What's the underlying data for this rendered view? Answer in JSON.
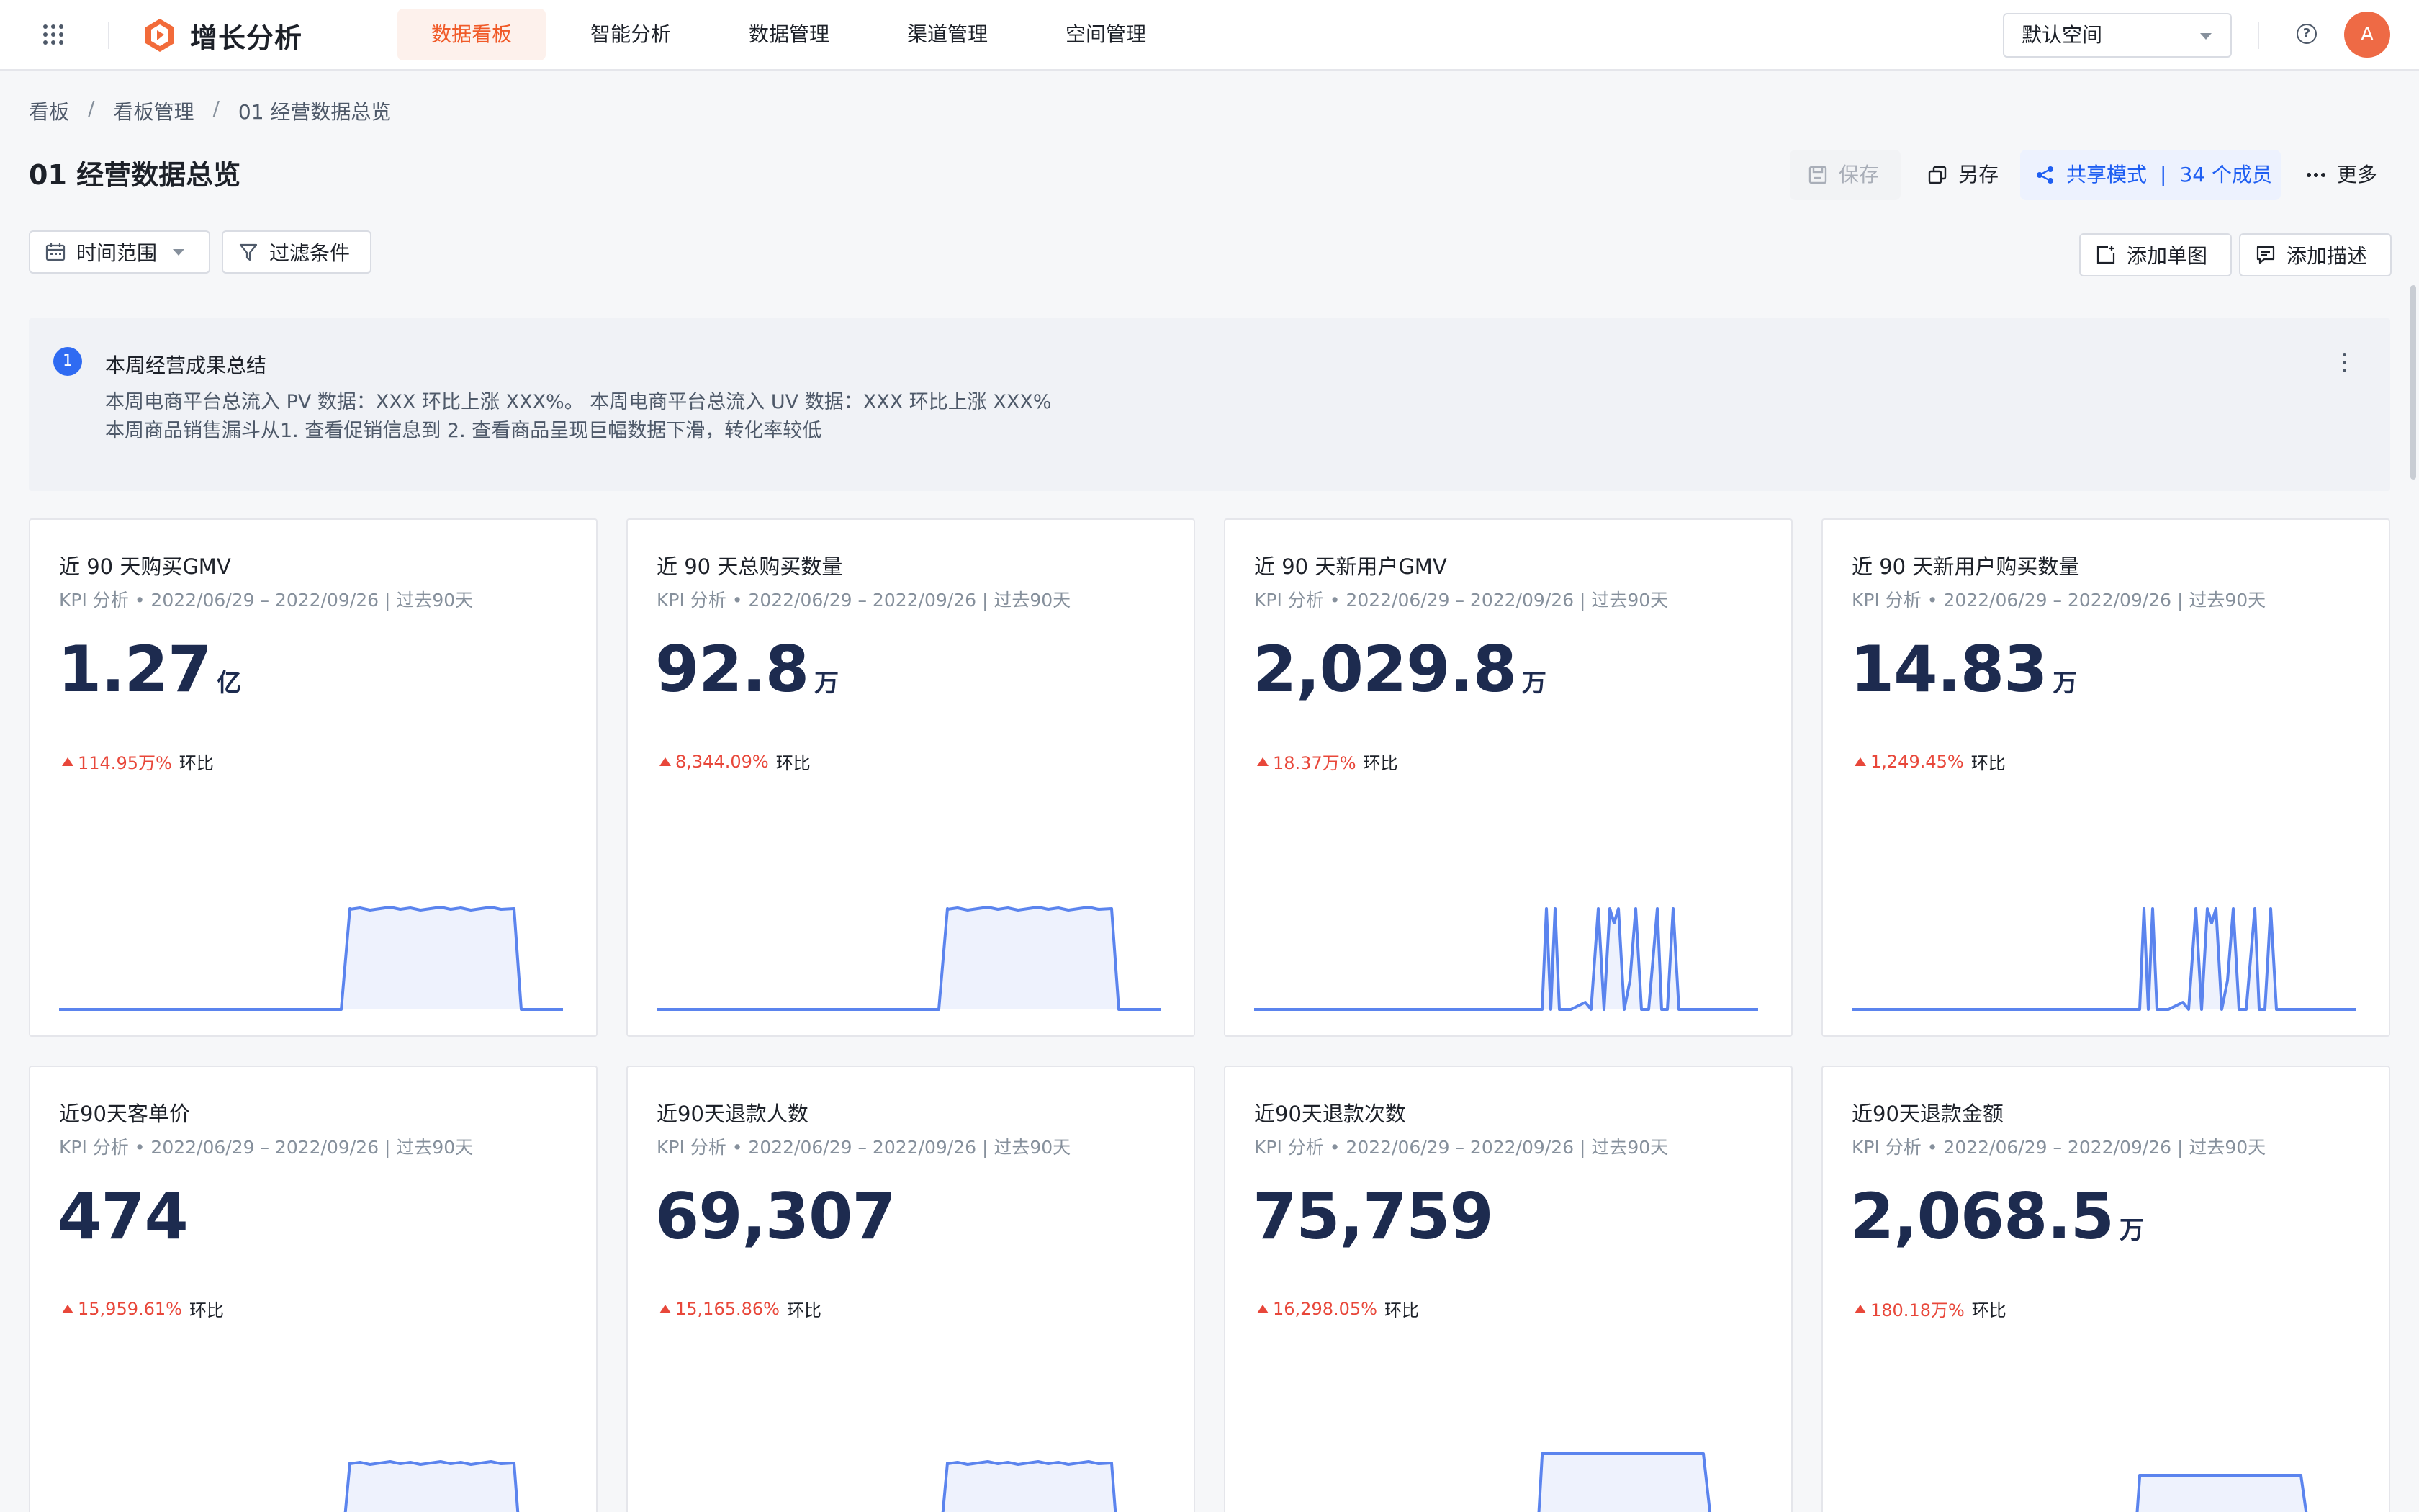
{
  "app": {
    "name": "增长分析",
    "colors": {
      "brand": "#f05a28",
      "accent": "#1e5ef2",
      "up": "#e8473a",
      "spark": "#5b84ee"
    }
  },
  "nav": {
    "items": [
      {
        "label": "数据看板",
        "active": true
      },
      {
        "label": "智能分析",
        "active": false
      },
      {
        "label": "数据管理",
        "active": false
      },
      {
        "label": "渠道管理",
        "active": false
      },
      {
        "label": "空间管理",
        "active": false
      }
    ],
    "space_select": "默认空间",
    "help_icon": "question-circle-icon",
    "avatar_letter": "A"
  },
  "breadcrumb": [
    "看板",
    "看板管理",
    "01 经营数据总览"
  ],
  "breadcrumb_sep": "/",
  "page_title": "01 经营数据总览",
  "actions": {
    "save": "保存",
    "save_as": "另存",
    "share_mode": "共享模式",
    "share_sep": "|",
    "share_members": "34 个成员",
    "more": "更多",
    "time_range": "时间范围",
    "filter": "过滤条件",
    "add_chart": "添加单图",
    "add_desc": "添加描述"
  },
  "summary": {
    "index": "1",
    "title": "本周经营成果总结",
    "lines": [
      "本周电商平台总流入 PV 数据：XXX 环比上涨 XXX%。 本周电商平台总流入 UV 数据：XXX 环比上涨 XXX%",
      "本周商品销售漏斗从1. 查看促销信息到 2. 查看商品呈现巨幅数据下滑，转化率较低"
    ]
  },
  "cards": [
    {
      "title": "近 90 天购买GMV",
      "subtitle": "KPI 分析 • 2022/06/29 – 2022/09/26 | 过去90天",
      "value": "1.27",
      "unit": "亿",
      "delta": "114.95万%",
      "delta_label": "环比"
    },
    {
      "title": "近 90 天总购买数量",
      "subtitle": "KPI 分析 • 2022/06/29 – 2022/09/26 | 过去90天",
      "value": "92.8",
      "unit": "万",
      "delta": "8,344.09%",
      "delta_label": "环比"
    },
    {
      "title": "近 90 天新用户GMV",
      "subtitle": "KPI 分析 • 2022/06/29 – 2022/09/26 | 过去90天",
      "value": "2,029.8",
      "unit": "万",
      "delta": "18.37万%",
      "delta_label": "环比"
    },
    {
      "title": "近 90 天新用户购买数量",
      "subtitle": "KPI 分析 • 2022/06/29 – 2022/09/26 | 过去90天",
      "value": "14.83",
      "unit": "万",
      "delta": "1,249.45%",
      "delta_label": "环比"
    },
    {
      "title": "近90天客单价",
      "subtitle": "KPI 分析 • 2022/06/29 – 2022/09/26 | 过去90天",
      "value": "474",
      "unit": "",
      "delta": "15,959.61%",
      "delta_label": "环比"
    },
    {
      "title": "近90天退款人数",
      "subtitle": "KPI 分析 • 2022/06/29 – 2022/09/26 | 过去90天",
      "value": "69,307",
      "unit": "",
      "delta": "15,165.86%",
      "delta_label": "环比"
    },
    {
      "title": "近90天退款次数",
      "subtitle": "KPI 分析 • 2022/06/29 – 2022/09/26 | 过去90天",
      "value": "75,759",
      "unit": "",
      "delta": "16,298.05%",
      "delta_label": "环比"
    },
    {
      "title": "近90天退款金额",
      "subtitle": "KPI 分析 • 2022/06/29 – 2022/09/26 | 过去90天",
      "value": "2,068.5",
      "unit": "万",
      "delta": "180.18万%",
      "delta_label": "环比"
    }
  ]
}
